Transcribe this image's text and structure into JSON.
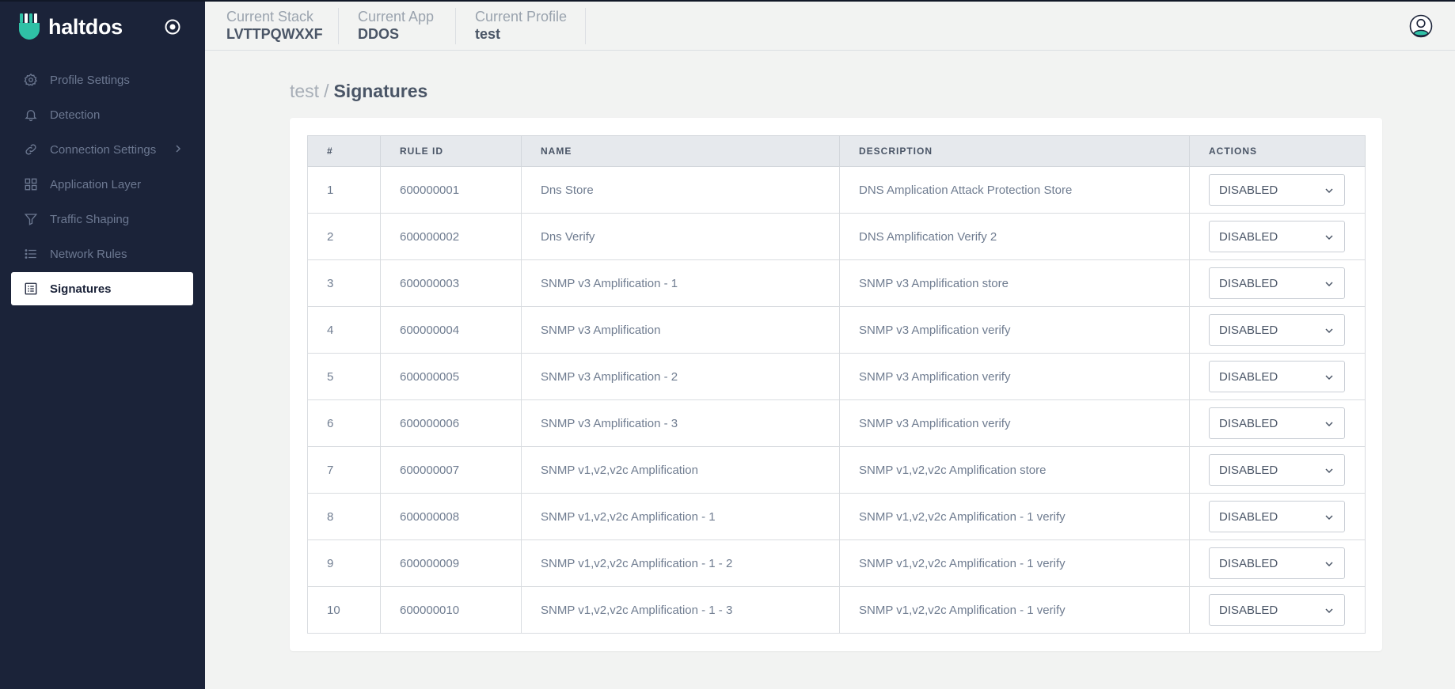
{
  "app": {
    "name": "haltdos"
  },
  "colors": {
    "sidebar_bg": "#1b2339",
    "accent": "#2fc1a6",
    "active_bg": "#ffffff"
  },
  "sidebar": {
    "items": [
      {
        "label": "Profile Settings",
        "icon": "gear-icon",
        "active": false
      },
      {
        "label": "Detection",
        "icon": "bell-icon",
        "active": false
      },
      {
        "label": "Connection Settings",
        "icon": "link-icon",
        "active": false,
        "has_submenu": true
      },
      {
        "label": "Application Layer",
        "icon": "grid-icon",
        "active": false
      },
      {
        "label": "Traffic Shaping",
        "icon": "filter-icon",
        "active": false
      },
      {
        "label": "Network Rules",
        "icon": "list-icon",
        "active": false
      },
      {
        "label": "Signatures",
        "icon": "document-list-icon",
        "active": true
      }
    ]
  },
  "header": {
    "stack": {
      "label": "Current Stack",
      "value": "LVTTPQWXXF"
    },
    "app": {
      "label": "Current App",
      "value": "DDOS"
    },
    "profile": {
      "label": "Current Profile",
      "value": "test"
    }
  },
  "breadcrumb": {
    "parent": "test",
    "separator": "/",
    "current": "Signatures"
  },
  "table": {
    "columns": [
      "#",
      "RULE ID",
      "NAME",
      "DESCRIPTION",
      "ACTIONS"
    ],
    "rows": [
      {
        "num": "1",
        "rule_id": "600000001",
        "name": "Dns Store",
        "description": "DNS Amplication Attack Protection Store",
        "action": "DISABLED"
      },
      {
        "num": "2",
        "rule_id": "600000002",
        "name": "Dns Verify",
        "description": "DNS Amplification Verify 2",
        "action": "DISABLED"
      },
      {
        "num": "3",
        "rule_id": "600000003",
        "name": "SNMP v3 Amplification - 1",
        "description": "SNMP v3 Amplification store",
        "action": "DISABLED"
      },
      {
        "num": "4",
        "rule_id": "600000004",
        "name": "SNMP v3 Amplification",
        "description": "SNMP v3 Amplification verify",
        "action": "DISABLED"
      },
      {
        "num": "5",
        "rule_id": "600000005",
        "name": "SNMP v3 Amplification - 2",
        "description": "SNMP v3 Amplification verify",
        "action": "DISABLED"
      },
      {
        "num": "6",
        "rule_id": "600000006",
        "name": "SNMP v3 Amplification - 3",
        "description": "SNMP v3 Amplification verify",
        "action": "DISABLED"
      },
      {
        "num": "7",
        "rule_id": "600000007",
        "name": "SNMP v1,v2,v2c Amplification",
        "description": "SNMP v1,v2,v2c Amplification store",
        "action": "DISABLED"
      },
      {
        "num": "8",
        "rule_id": "600000008",
        "name": "SNMP v1,v2,v2c Amplification - 1",
        "description": "SNMP v1,v2,v2c Amplification - 1 verify",
        "action": "DISABLED"
      },
      {
        "num": "9",
        "rule_id": "600000009",
        "name": "SNMP v1,v2,v2c Amplification - 1 - 2",
        "description": "SNMP v1,v2,v2c Amplification - 1 verify",
        "action": "DISABLED"
      },
      {
        "num": "10",
        "rule_id": "600000010",
        "name": "SNMP v1,v2,v2c Amplification - 1 - 3",
        "description": "SNMP v1,v2,v2c Amplification - 1 verify",
        "action": "DISABLED"
      }
    ]
  }
}
